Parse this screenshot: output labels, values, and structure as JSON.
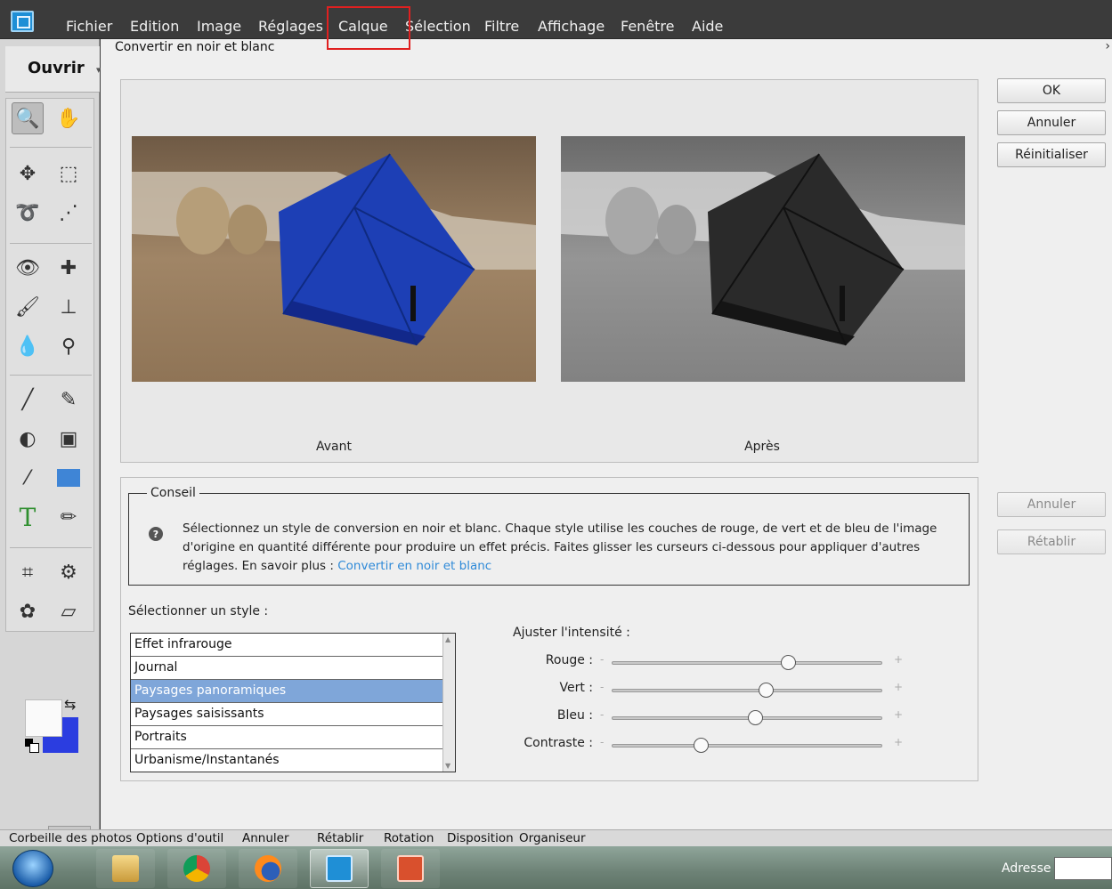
{
  "menu": {
    "items": [
      "Fichier",
      "Edition",
      "Image",
      "Réglages",
      "Calque",
      "Sélection",
      "Filtre",
      "Affichage",
      "Fenêtre",
      "Aide"
    ]
  },
  "sidebar": {
    "open_label": "Ouvrir"
  },
  "dialog": {
    "title": "Convertir en noir et blanc",
    "preview_before": "Avant",
    "preview_after": "Après",
    "buttons": {
      "ok": "OK",
      "cancel": "Annuler",
      "reset": "Réinitialiser",
      "undo": "Annuler",
      "redo": "Rétablir"
    },
    "tip": {
      "legend": "Conseil",
      "text": "Sélectionnez un style de conversion en noir et blanc. Chaque style utilise les couches de rouge, de vert et de bleu de l'image d'origine en quantité différente pour produire un effet précis. Faites glisser les curseurs ci-dessous pour appliquer d'autres réglages. En savoir plus :",
      "link": "Convertir en noir et blanc"
    },
    "style_label": "Sélectionner un style :",
    "styles": [
      "Effet infrarouge",
      "Journal",
      "Paysages panoramiques",
      "Paysages saisissants",
      "Portraits",
      "Urbanisme/Instantanés"
    ],
    "selected_style": "Paysages panoramiques",
    "intensity_label": "Ajuster l'intensité :",
    "minus_sign": "-",
    "plus_sign": "+",
    "sliders": [
      {
        "label": "Rouge :",
        "value": 0.65
      },
      {
        "label": "Vert :",
        "value": 0.57
      },
      {
        "label": "Bleu :",
        "value": 0.53
      },
      {
        "label": "Contraste :",
        "value": 0.33
      }
    ]
  },
  "bottom_bar": {
    "items": [
      "Corbeille des photos",
      "Options d'outil",
      "Annuler",
      "Rétablir",
      "Rotation",
      "Disposition",
      "Organiseur"
    ]
  },
  "taskbar": {
    "address_label": "Adresse"
  },
  "colors": {
    "foreground": "#fafafa",
    "background": "#2b3de0",
    "selection": "#7fa6d9",
    "link": "#2f8ad8",
    "highlight_box": "#e02020"
  }
}
